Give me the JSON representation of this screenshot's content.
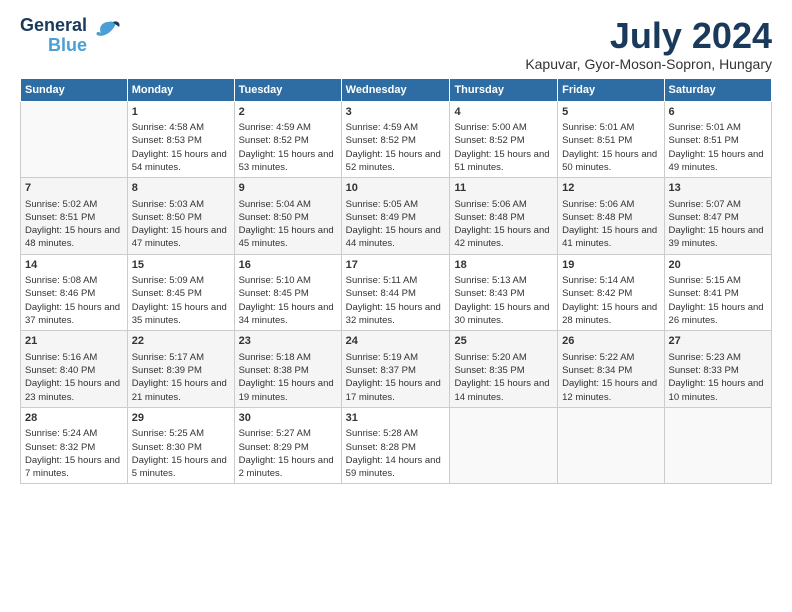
{
  "header": {
    "logo_line1": "General",
    "logo_line2": "Blue",
    "month": "July 2024",
    "location": "Kapuvar, Gyor-Moson-Sopron, Hungary"
  },
  "days_of_week": [
    "Sunday",
    "Monday",
    "Tuesday",
    "Wednesday",
    "Thursday",
    "Friday",
    "Saturday"
  ],
  "weeks": [
    [
      {
        "day": "",
        "sunrise": "",
        "sunset": "",
        "daylight": ""
      },
      {
        "day": "1",
        "sunrise": "Sunrise: 4:58 AM",
        "sunset": "Sunset: 8:53 PM",
        "daylight": "Daylight: 15 hours and 54 minutes."
      },
      {
        "day": "2",
        "sunrise": "Sunrise: 4:59 AM",
        "sunset": "Sunset: 8:52 PM",
        "daylight": "Daylight: 15 hours and 53 minutes."
      },
      {
        "day": "3",
        "sunrise": "Sunrise: 4:59 AM",
        "sunset": "Sunset: 8:52 PM",
        "daylight": "Daylight: 15 hours and 52 minutes."
      },
      {
        "day": "4",
        "sunrise": "Sunrise: 5:00 AM",
        "sunset": "Sunset: 8:52 PM",
        "daylight": "Daylight: 15 hours and 51 minutes."
      },
      {
        "day": "5",
        "sunrise": "Sunrise: 5:01 AM",
        "sunset": "Sunset: 8:51 PM",
        "daylight": "Daylight: 15 hours and 50 minutes."
      },
      {
        "day": "6",
        "sunrise": "Sunrise: 5:01 AM",
        "sunset": "Sunset: 8:51 PM",
        "daylight": "Daylight: 15 hours and 49 minutes."
      }
    ],
    [
      {
        "day": "7",
        "sunrise": "Sunrise: 5:02 AM",
        "sunset": "Sunset: 8:51 PM",
        "daylight": "Daylight: 15 hours and 48 minutes."
      },
      {
        "day": "8",
        "sunrise": "Sunrise: 5:03 AM",
        "sunset": "Sunset: 8:50 PM",
        "daylight": "Daylight: 15 hours and 47 minutes."
      },
      {
        "day": "9",
        "sunrise": "Sunrise: 5:04 AM",
        "sunset": "Sunset: 8:50 PM",
        "daylight": "Daylight: 15 hours and 45 minutes."
      },
      {
        "day": "10",
        "sunrise": "Sunrise: 5:05 AM",
        "sunset": "Sunset: 8:49 PM",
        "daylight": "Daylight: 15 hours and 44 minutes."
      },
      {
        "day": "11",
        "sunrise": "Sunrise: 5:06 AM",
        "sunset": "Sunset: 8:48 PM",
        "daylight": "Daylight: 15 hours and 42 minutes."
      },
      {
        "day": "12",
        "sunrise": "Sunrise: 5:06 AM",
        "sunset": "Sunset: 8:48 PM",
        "daylight": "Daylight: 15 hours and 41 minutes."
      },
      {
        "day": "13",
        "sunrise": "Sunrise: 5:07 AM",
        "sunset": "Sunset: 8:47 PM",
        "daylight": "Daylight: 15 hours and 39 minutes."
      }
    ],
    [
      {
        "day": "14",
        "sunrise": "Sunrise: 5:08 AM",
        "sunset": "Sunset: 8:46 PM",
        "daylight": "Daylight: 15 hours and 37 minutes."
      },
      {
        "day": "15",
        "sunrise": "Sunrise: 5:09 AM",
        "sunset": "Sunset: 8:45 PM",
        "daylight": "Daylight: 15 hours and 35 minutes."
      },
      {
        "day": "16",
        "sunrise": "Sunrise: 5:10 AM",
        "sunset": "Sunset: 8:45 PM",
        "daylight": "Daylight: 15 hours and 34 minutes."
      },
      {
        "day": "17",
        "sunrise": "Sunrise: 5:11 AM",
        "sunset": "Sunset: 8:44 PM",
        "daylight": "Daylight: 15 hours and 32 minutes."
      },
      {
        "day": "18",
        "sunrise": "Sunrise: 5:13 AM",
        "sunset": "Sunset: 8:43 PM",
        "daylight": "Daylight: 15 hours and 30 minutes."
      },
      {
        "day": "19",
        "sunrise": "Sunrise: 5:14 AM",
        "sunset": "Sunset: 8:42 PM",
        "daylight": "Daylight: 15 hours and 28 minutes."
      },
      {
        "day": "20",
        "sunrise": "Sunrise: 5:15 AM",
        "sunset": "Sunset: 8:41 PM",
        "daylight": "Daylight: 15 hours and 26 minutes."
      }
    ],
    [
      {
        "day": "21",
        "sunrise": "Sunrise: 5:16 AM",
        "sunset": "Sunset: 8:40 PM",
        "daylight": "Daylight: 15 hours and 23 minutes."
      },
      {
        "day": "22",
        "sunrise": "Sunrise: 5:17 AM",
        "sunset": "Sunset: 8:39 PM",
        "daylight": "Daylight: 15 hours and 21 minutes."
      },
      {
        "day": "23",
        "sunrise": "Sunrise: 5:18 AM",
        "sunset": "Sunset: 8:38 PM",
        "daylight": "Daylight: 15 hours and 19 minutes."
      },
      {
        "day": "24",
        "sunrise": "Sunrise: 5:19 AM",
        "sunset": "Sunset: 8:37 PM",
        "daylight": "Daylight: 15 hours and 17 minutes."
      },
      {
        "day": "25",
        "sunrise": "Sunrise: 5:20 AM",
        "sunset": "Sunset: 8:35 PM",
        "daylight": "Daylight: 15 hours and 14 minutes."
      },
      {
        "day": "26",
        "sunrise": "Sunrise: 5:22 AM",
        "sunset": "Sunset: 8:34 PM",
        "daylight": "Daylight: 15 hours and 12 minutes."
      },
      {
        "day": "27",
        "sunrise": "Sunrise: 5:23 AM",
        "sunset": "Sunset: 8:33 PM",
        "daylight": "Daylight: 15 hours and 10 minutes."
      }
    ],
    [
      {
        "day": "28",
        "sunrise": "Sunrise: 5:24 AM",
        "sunset": "Sunset: 8:32 PM",
        "daylight": "Daylight: 15 hours and 7 minutes."
      },
      {
        "day": "29",
        "sunrise": "Sunrise: 5:25 AM",
        "sunset": "Sunset: 8:30 PM",
        "daylight": "Daylight: 15 hours and 5 minutes."
      },
      {
        "day": "30",
        "sunrise": "Sunrise: 5:27 AM",
        "sunset": "Sunset: 8:29 PM",
        "daylight": "Daylight: 15 hours and 2 minutes."
      },
      {
        "day": "31",
        "sunrise": "Sunrise: 5:28 AM",
        "sunset": "Sunset: 8:28 PM",
        "daylight": "Daylight: 14 hours and 59 minutes."
      },
      {
        "day": "",
        "sunrise": "",
        "sunset": "",
        "daylight": ""
      },
      {
        "day": "",
        "sunrise": "",
        "sunset": "",
        "daylight": ""
      },
      {
        "day": "",
        "sunrise": "",
        "sunset": "",
        "daylight": ""
      }
    ]
  ]
}
